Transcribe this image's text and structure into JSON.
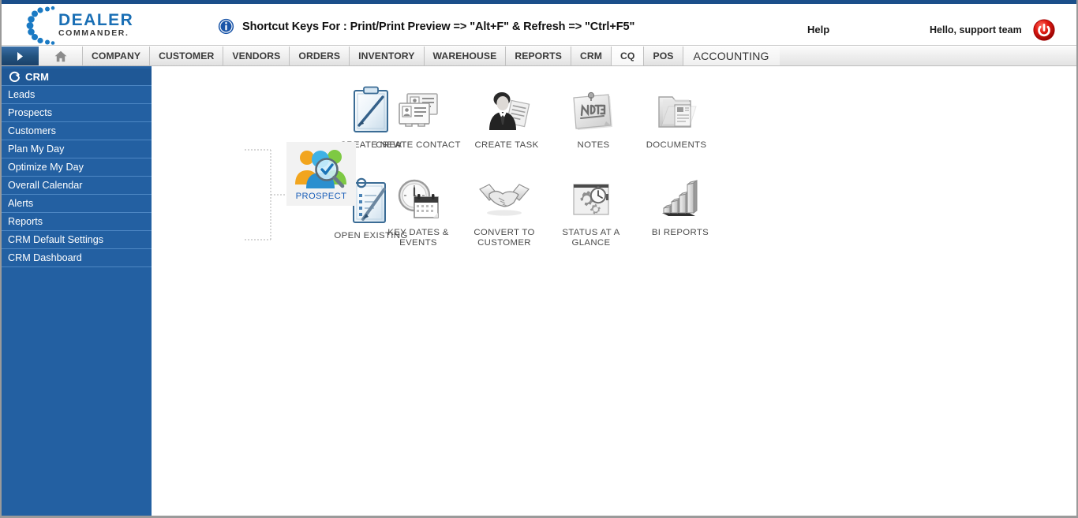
{
  "brand": {
    "name_line1": "DEALER",
    "name_line2": "COMMANDER.",
    "accent_color": "#1a6fb5"
  },
  "header": {
    "shortcut_text": "Shortcut Keys For : Print/Print Preview => \"Alt+F\" & Refresh => \"Ctrl+F5\"",
    "help_label": "Help",
    "greeting": "Hello, support team",
    "info_icon": "info-icon",
    "power_icon": "power-icon",
    "power_color": "#cc0000"
  },
  "navbar": {
    "expand_icon": "chevron-right-icon",
    "home_icon": "home-icon",
    "items": [
      {
        "label": "COMPANY",
        "active": false
      },
      {
        "label": "CUSTOMER",
        "active": false
      },
      {
        "label": "VENDORS",
        "active": false
      },
      {
        "label": "ORDERS",
        "active": false
      },
      {
        "label": "INVENTORY",
        "active": false
      },
      {
        "label": "WAREHOUSE",
        "active": false
      },
      {
        "label": "REPORTS",
        "active": false
      },
      {
        "label": "CRM",
        "active": false
      },
      {
        "label": "CQ",
        "active": true
      },
      {
        "label": "POS",
        "active": false
      }
    ],
    "accounting_label": "ACCOUNTING",
    "accent_color": "#2360a2"
  },
  "sidebar": {
    "title": "CRM",
    "refresh_icon": "refresh-icon",
    "background_color": "#2360a2",
    "items": [
      {
        "label": "Leads"
      },
      {
        "label": "Prospects"
      },
      {
        "label": "Customers"
      },
      {
        "label": "Plan My Day"
      },
      {
        "label": "Optimize My Day"
      },
      {
        "label": "Overall Calendar"
      },
      {
        "label": "Alerts"
      },
      {
        "label": "Reports"
      },
      {
        "label": "CRM Default Settings"
      },
      {
        "label": "CRM Dashboard"
      }
    ]
  },
  "workspace": {
    "center": {
      "label": "PROSPECT",
      "icon": "people-search-icon",
      "label_color": "#1a5eb8"
    },
    "left_tiles": [
      {
        "label": "CREATE NEW",
        "icon": "clipboard-blank-icon"
      },
      {
        "label": "OPEN EXISTING",
        "icon": "clipboard-checklist-pen-icon"
      }
    ],
    "action_tiles": [
      {
        "label": "CREATE CONTACT",
        "icon": "contact-cards-icon"
      },
      {
        "label": "CREATE TASK",
        "icon": "businessman-document-icon"
      },
      {
        "label": "NOTES",
        "icon": "pinned-note-icon"
      },
      {
        "label": "DOCUMENTS",
        "icon": "folder-documents-icon"
      },
      {
        "label": "KEY DATES & EVENTS",
        "icon": "clock-calendar-icon"
      },
      {
        "label": "CONVERT TO CUSTOMER",
        "icon": "handshake-icon"
      },
      {
        "label": "STATUS AT A GLANCE",
        "icon": "gears-stopwatch-icon"
      },
      {
        "label": "BI REPORTS",
        "icon": "bar-chart-3d-icon"
      }
    ]
  }
}
